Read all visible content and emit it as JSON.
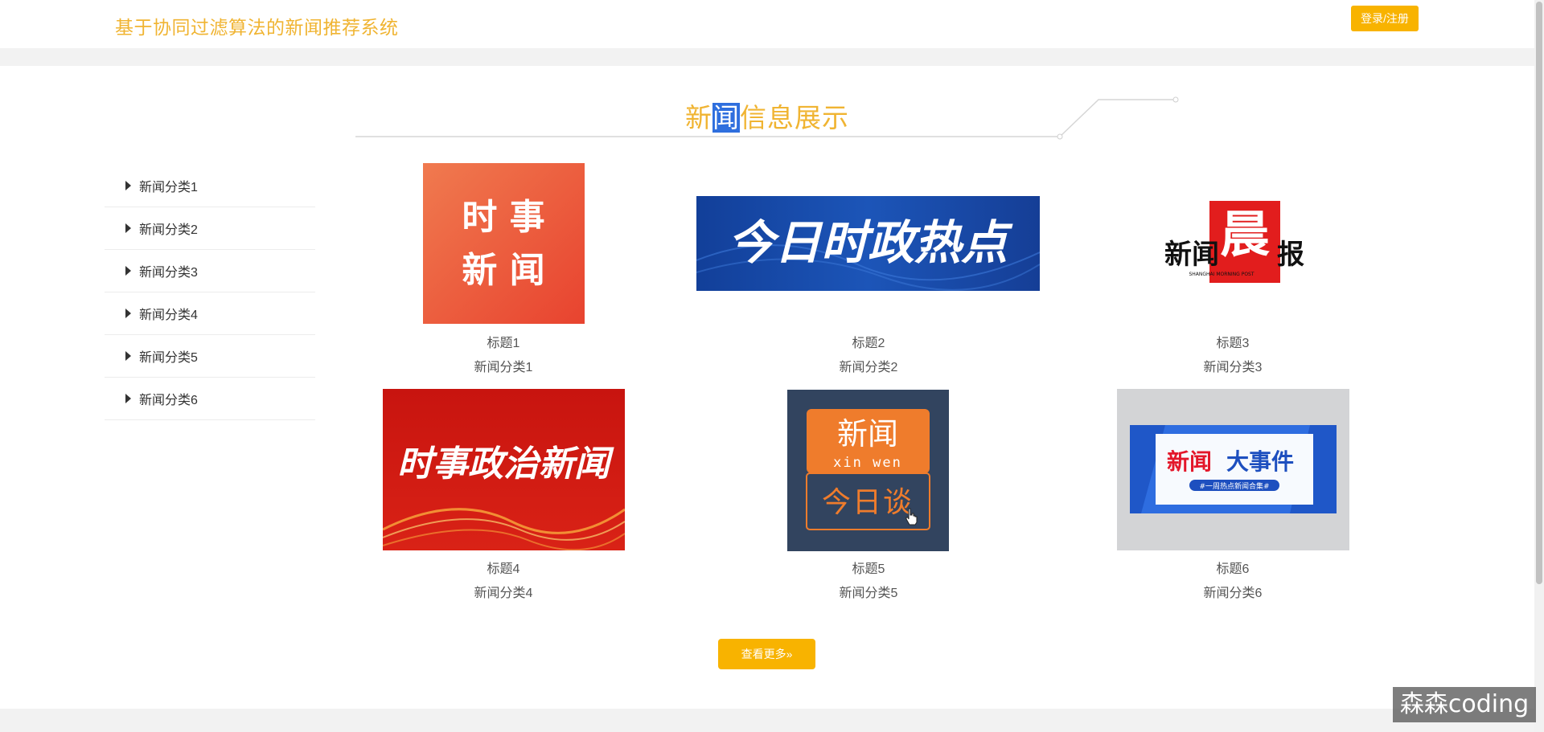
{
  "header": {
    "site_title": "基于协同过滤算法的新闻推荐系统",
    "login_label": "登录/注册",
    "title_color": "#f0b432",
    "accent_color": "#f8b300"
  },
  "section": {
    "title_pre": "新",
    "title_highlight": "闻",
    "title_post": "信息展示"
  },
  "sidebar": {
    "items": [
      {
        "label": "新闻分类1"
      },
      {
        "label": "新闻分类2"
      },
      {
        "label": "新闻分类3"
      },
      {
        "label": "新闻分类4"
      },
      {
        "label": "新闻分类5"
      },
      {
        "label": "新闻分类6"
      }
    ]
  },
  "cards": [
    {
      "title": "标题1",
      "category": "新闻分类1",
      "image_text": [
        "时 事",
        "新 闻"
      ]
    },
    {
      "title": "标题2",
      "category": "新闻分类2",
      "image_text": "今日时政热点"
    },
    {
      "title": "标题3",
      "category": "新闻分类3",
      "image_text": [
        "新闻",
        "晨",
        "报",
        "SHANGHAI MORNING POST"
      ]
    },
    {
      "title": "标题4",
      "category": "新闻分类4",
      "image_text": "时事政治新闻"
    },
    {
      "title": "标题5",
      "category": "新闻分类5",
      "image_text": [
        "新闻",
        "xin wen",
        "今日谈"
      ]
    },
    {
      "title": "标题6",
      "category": "新闻分类6",
      "image_text": [
        "新闻",
        "大事件",
        "#一周热点新闻合集#"
      ]
    }
  ],
  "more_label": "查看更多»",
  "watermark": "森森coding"
}
